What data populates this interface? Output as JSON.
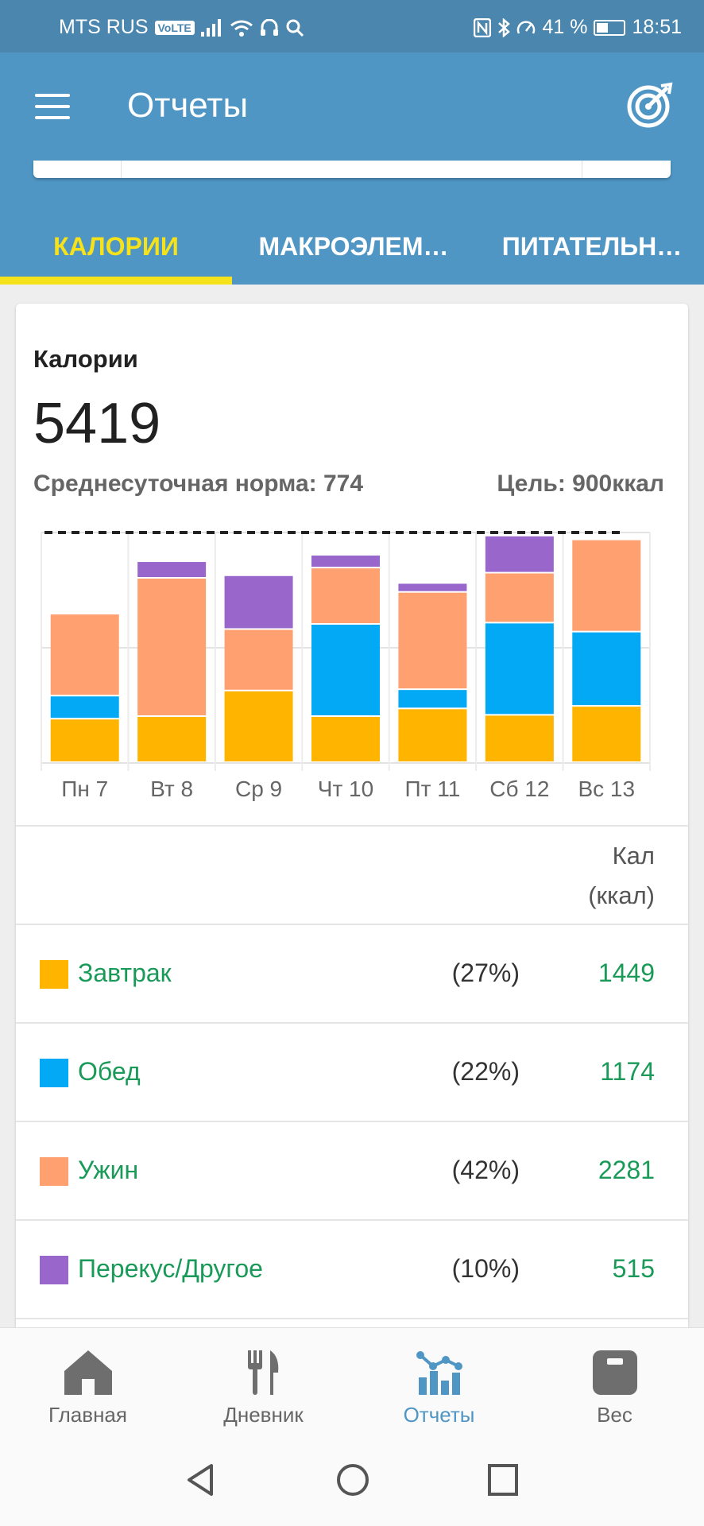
{
  "status_bar": {
    "carrier": "MTS RUS",
    "volte": "VoLTE",
    "battery": "41 %",
    "time": "18:51"
  },
  "app_bar": {
    "title": "Отчеты",
    "goal_icon": "target-icon",
    "menu_icon": "hamburger-icon"
  },
  "tabs": [
    {
      "label": "КАЛОРИИ",
      "active": true
    },
    {
      "label": "МАКРОЭЛЕМ…"
    },
    {
      "label": "ПИТАТЕЛЬН…"
    }
  ],
  "summary": {
    "label": "Калории",
    "total": "5419",
    "average": "Среднесуточная норма: 774",
    "goal": "Цель: 900ккал"
  },
  "chart_data": {
    "type": "bar",
    "stacked": true,
    "categories": [
      "Пн 7",
      "Вт 8",
      "Ср 9",
      "Чт 10",
      "Пт 11",
      "Сб 12",
      "Вс 13"
    ],
    "series": [
      {
        "name": "Завтрак",
        "color": "#ffb400",
        "values": [
          170,
          180,
          280,
          180,
          210,
          185,
          220
        ]
      },
      {
        "name": "Обед",
        "color": "#03a9f4",
        "values": [
          90,
          0,
          0,
          360,
          75,
          360,
          290
        ]
      },
      {
        "name": "Ужин",
        "color": "#ffa070",
        "values": [
          320,
          540,
          240,
          220,
          380,
          195,
          360
        ]
      },
      {
        "name": "Перекус/Другое",
        "color": "#9966cc",
        "values": [
          0,
          65,
          210,
          50,
          35,
          145,
          0
        ]
      }
    ],
    "goal_line": 900,
    "ylim": [
      0,
      900
    ],
    "grid": true,
    "legend": "table-below"
  },
  "table": {
    "header_cal": [
      "Кал",
      "(ккал)"
    ],
    "rows": [
      {
        "name": "Завтрак",
        "percent": "(27%)",
        "value": "1449",
        "color": "#ffb400"
      },
      {
        "name": "Обед",
        "percent": "(22%)",
        "value": "1174",
        "color": "#03a9f4"
      },
      {
        "name": "Ужин",
        "percent": "(42%)",
        "value": "2281",
        "color": "#ffa070"
      },
      {
        "name": "Перекус/Другое",
        "percent": "(10%)",
        "value": "515",
        "color": "#9966cc"
      }
    ]
  },
  "bottom_nav": [
    {
      "label": "Главная",
      "icon": "home-icon"
    },
    {
      "label": "Дневник",
      "icon": "fork-knife-icon"
    },
    {
      "label": "Отчеты",
      "icon": "chart-icon",
      "active": true
    },
    {
      "label": "Вес",
      "icon": "scale-icon"
    }
  ]
}
